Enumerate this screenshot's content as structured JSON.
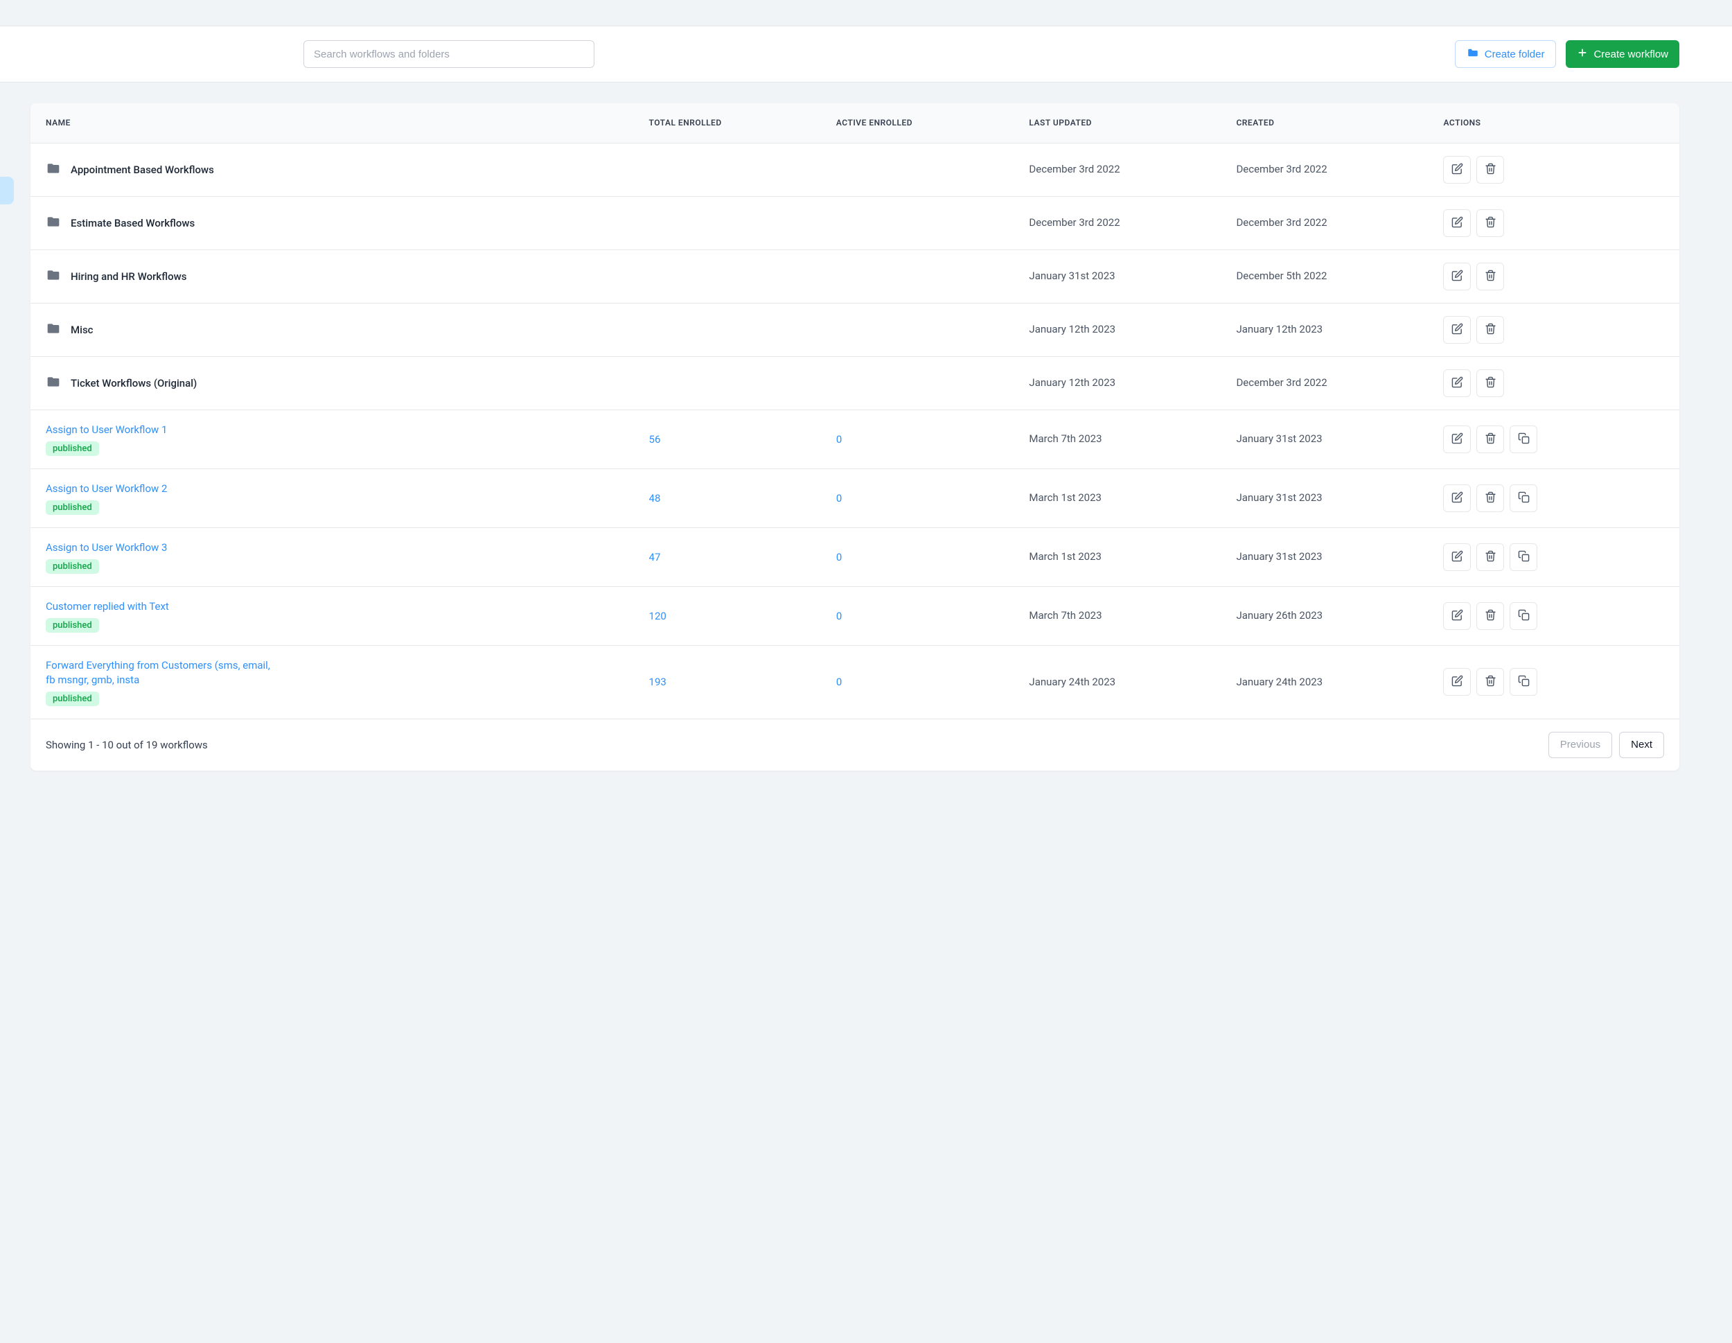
{
  "toolbar": {
    "search_placeholder": "Search workflows and folders",
    "create_folder_label": "Create folder",
    "create_workflow_label": "Create workflow"
  },
  "columns": {
    "name": "NAME",
    "total_enrolled": "TOTAL ENROLLED",
    "active_enrolled": "ACTIVE ENROLLED",
    "last_updated": "LAST UPDATED",
    "created": "CREATED",
    "actions": "ACTIONS"
  },
  "rows": [
    {
      "type": "folder",
      "name": "Appointment Based Workflows",
      "last_updated": "December 3rd 2022",
      "created": "December 3rd 2022"
    },
    {
      "type": "folder",
      "name": "Estimate Based Workflows",
      "last_updated": "December 3rd 2022",
      "created": "December 3rd 2022"
    },
    {
      "type": "folder",
      "name": "Hiring and HR Workflows",
      "last_updated": "January 31st 2023",
      "created": "December 5th 2022"
    },
    {
      "type": "folder",
      "name": "Misc",
      "last_updated": "January 12th 2023",
      "created": "January 12th 2023"
    },
    {
      "type": "folder",
      "name": "Ticket Workflows (Original)",
      "last_updated": "January 12th 2023",
      "created": "December 3rd 2022"
    },
    {
      "type": "workflow",
      "name": "Assign to User Workflow 1",
      "status": "published",
      "total": "56",
      "active": "0",
      "last_updated": "March 7th 2023",
      "created": "January 31st 2023"
    },
    {
      "type": "workflow",
      "name": "Assign to User Workflow 2",
      "status": "published",
      "total": "48",
      "active": "0",
      "last_updated": "March 1st 2023",
      "created": "January 31st 2023"
    },
    {
      "type": "workflow",
      "name": "Assign to User Workflow 3",
      "status": "published",
      "total": "47",
      "active": "0",
      "last_updated": "March 1st 2023",
      "created": "January 31st 2023"
    },
    {
      "type": "workflow",
      "name": "Customer replied with Text",
      "status": "published",
      "total": "120",
      "active": "0",
      "last_updated": "March 7th 2023",
      "created": "January 26th 2023"
    },
    {
      "type": "workflow",
      "name": "Forward Everything from Customers (sms, email, fb msngr, gmb, insta",
      "status": "published",
      "total": "193",
      "active": "0",
      "last_updated": "January 24th 2023",
      "created": "January 24th 2023"
    }
  ],
  "footer": {
    "showing_text": "Showing 1 - 10 out of 19 workflows",
    "prev_label": "Previous",
    "next_label": "Next"
  }
}
